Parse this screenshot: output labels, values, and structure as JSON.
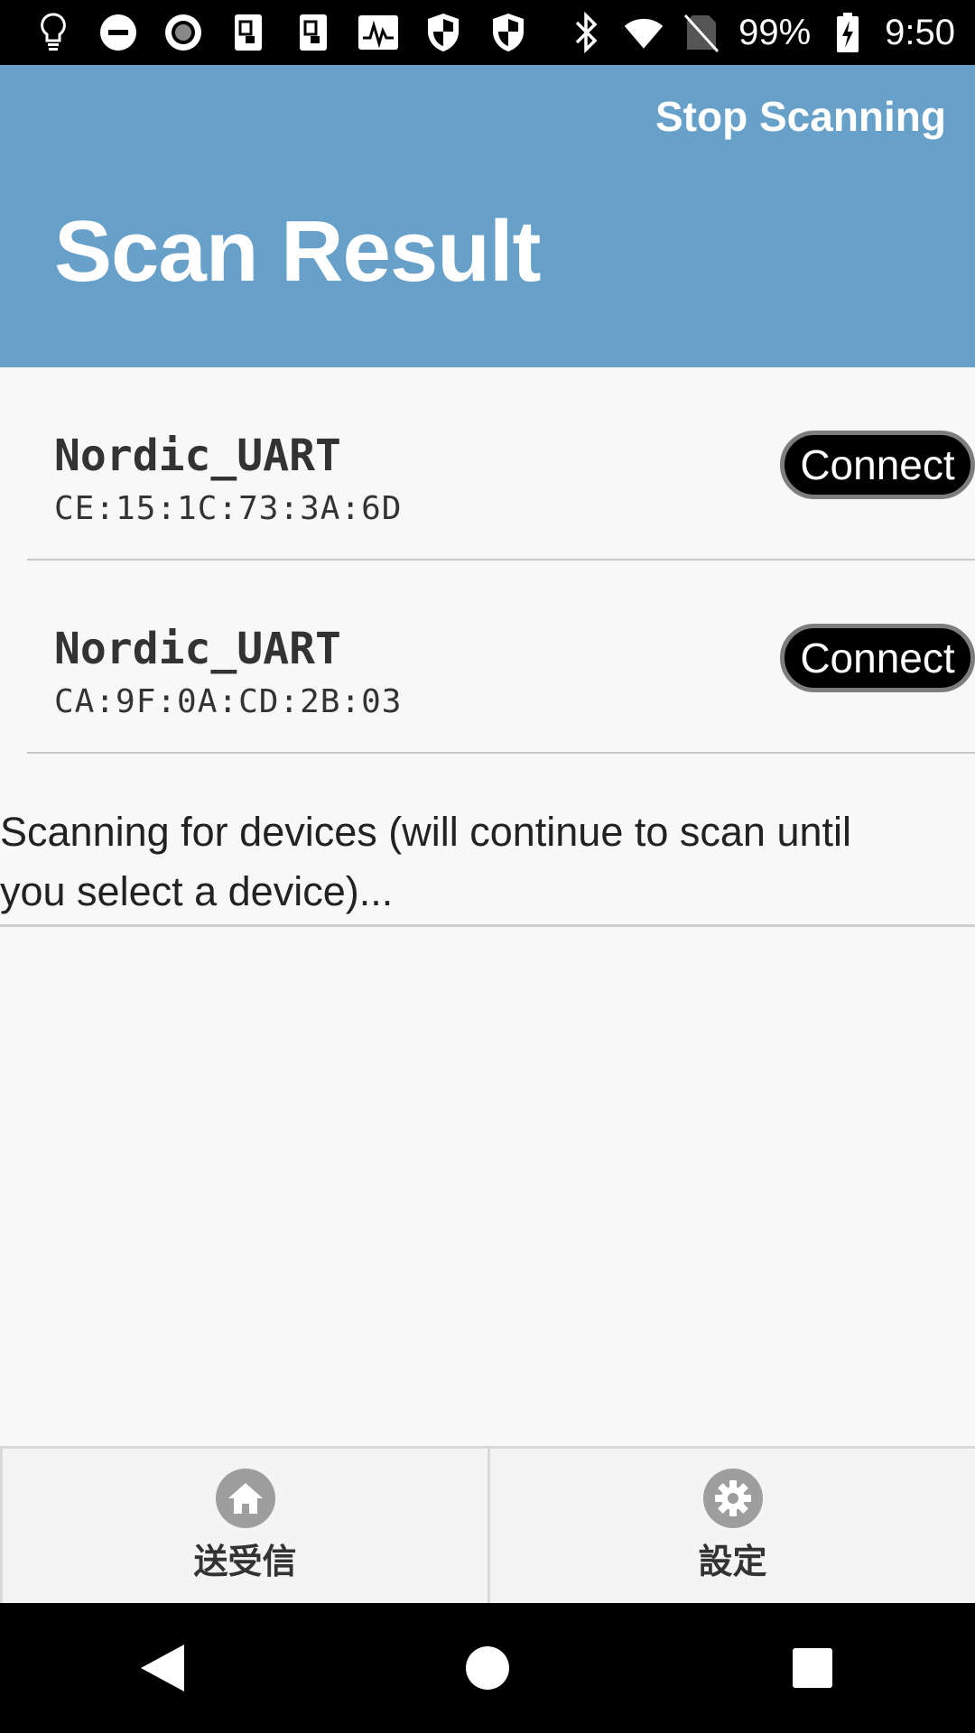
{
  "status_bar": {
    "icons_left": [
      "lightbulb-icon",
      "do-not-disturb-icon",
      "record-icon",
      "nfc-card-icon",
      "nfc-card-icon-2",
      "activity-icon",
      "shield-icon",
      "shield-icon-2"
    ],
    "battery": "99%",
    "time": "9:50"
  },
  "app_bar": {
    "action_label": "Stop Scanning",
    "title": "Scan Result",
    "color": "#67a0c9"
  },
  "devices": [
    {
      "name": "Nordic_UART",
      "address": "CE:15:1C:73:3A:6D",
      "button": "Connect"
    },
    {
      "name": "Nordic_UART",
      "address": "CA:9F:0A:CD:2B:03",
      "button": "Connect"
    }
  ],
  "scan_status": {
    "line1": "Scanning for devices (will continue to scan until",
    "line2": "you select a device)..."
  },
  "bottom_nav": [
    {
      "label": "送受信",
      "icon": "home-icon"
    },
    {
      "label": "設定",
      "icon": "gear-icon"
    }
  ]
}
